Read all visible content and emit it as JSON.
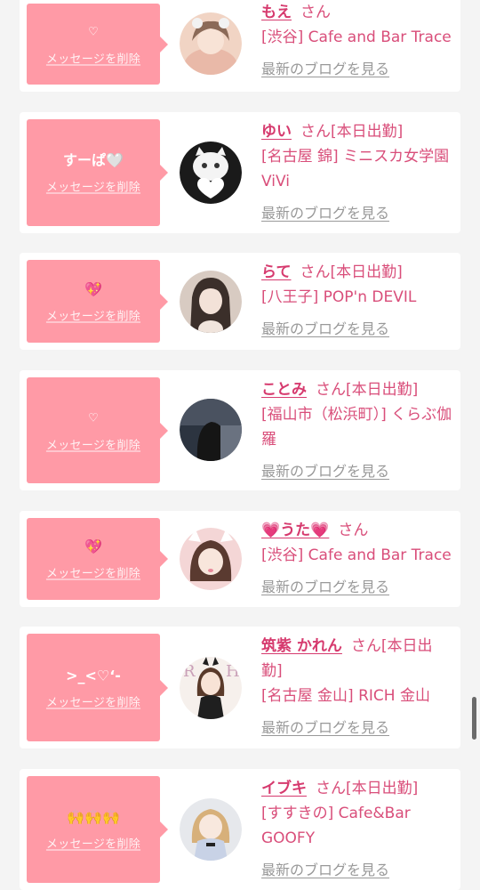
{
  "delete_label": "メッセージを削除",
  "blog_label": "最新のブログを見る",
  "san_suffix": "さん",
  "entries": [
    {
      "message": "♡",
      "name": "もえ",
      "status": "",
      "shop": "[渋谷] Cafe and Bar Trace",
      "avatar_colors": [
        "#f1d4c4",
        "#8b6a58"
      ]
    },
    {
      "message": "すーぱ🤍",
      "name": "ゆい",
      "status": "[本日出勤]",
      "shop": "[名古屋 錦] ミニスカ女学園ViVi",
      "avatar_colors": [
        "#1a1a1a",
        "#ffffff"
      ]
    },
    {
      "message": "💖",
      "name": "らて",
      "status": "[本日出勤]",
      "shop": "[八王子] POP'n DEVIL",
      "avatar_colors": [
        "#d8cbc2",
        "#3b2f2a"
      ]
    },
    {
      "message": "♡",
      "name": "ことみ",
      "status": "[本日出勤]",
      "shop": "[福山市（松浜町）] くらぶ伽羅",
      "avatar_colors": [
        "#2c3440",
        "#6a7280"
      ]
    },
    {
      "message": "💖",
      "name": "💗うた💗",
      "status": "",
      "shop": "[渋谷] Cafe and Bar Trace",
      "avatar_colors": [
        "#f4d6d6",
        "#5a3a30"
      ]
    },
    {
      "message": ">_<♡‘-",
      "name": "筑紫 かれん",
      "status": "[本日出勤]",
      "shop": "[名古屋 金山] RICH 金山",
      "avatar_colors": [
        "#f6f0ec",
        "#1f1f1f"
      ]
    },
    {
      "message": "🙌🙌🙌",
      "name": "イブキ",
      "status": "[本日出勤]",
      "shop": "[すすきの] Cafe&Bar GOOFY",
      "avatar_colors": [
        "#e6e8ec",
        "#d7b07a"
      ]
    }
  ]
}
